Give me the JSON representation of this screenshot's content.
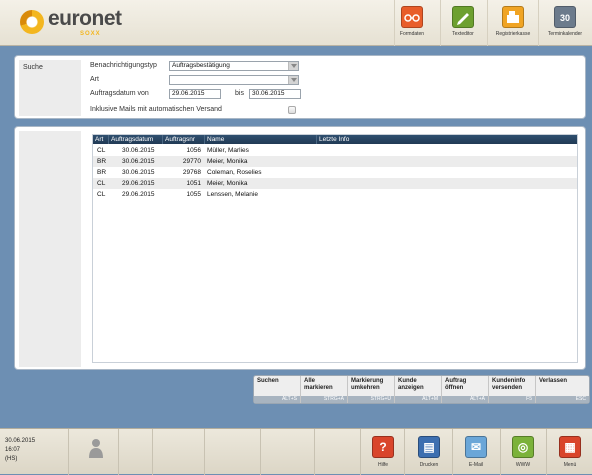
{
  "app": {
    "logo_name": "euronet",
    "logo_sub": "SOXX"
  },
  "toolbar": {
    "items": [
      {
        "label": "Formdaten",
        "icon": "glasses-icon",
        "color": "#e85d2a"
      },
      {
        "label": "Texteditor",
        "icon": "pencil-icon",
        "color": "#6da02f"
      },
      {
        "label": "Registrierkasse",
        "icon": "cash-register-icon",
        "color": "#f0a424"
      },
      {
        "label": "Terminkalender",
        "icon": "calendar-icon",
        "color": "#6c7b8c",
        "day": "30"
      }
    ]
  },
  "search": {
    "title": "Suche",
    "type_label": "Benachrichtigungstyp",
    "type_value": "Auftragsbestätigung",
    "art_label": "Art",
    "art_value": "",
    "date_label": "Auftragsdatum von",
    "date_from": "29.06.2015",
    "date_to_label": "bis",
    "date_to": "30.06.2015",
    "auto_mail_label": "Inklusive Mails mit automatischen Versand"
  },
  "results": {
    "columns": [
      "Art",
      "Auftragsdatum",
      "Auftragsnr",
      "Name",
      "Letzte Info"
    ],
    "rows": [
      {
        "art": "CL",
        "datum": "30.06.2015",
        "nr": "1056",
        "name": "Müller, Marlies",
        "info": ""
      },
      {
        "art": "BR",
        "datum": "30.06.2015",
        "nr": "29770",
        "name": "Meier, Monika",
        "info": ""
      },
      {
        "art": "BR",
        "datum": "30.06.2015",
        "nr": "29768",
        "name": "Coleman, Roselies",
        "info": ""
      },
      {
        "art": "CL",
        "datum": "29.06.2015",
        "nr": "1051",
        "name": "Meier, Monika",
        "info": ""
      },
      {
        "art": "CL",
        "datum": "29.06.2015",
        "nr": "1055",
        "name": "Lenssen, Melanie",
        "info": ""
      }
    ]
  },
  "fkeys": [
    {
      "l1": "Suchen",
      "l2": "",
      "key": "ALT+S"
    },
    {
      "l1": "Alle",
      "l2": "markieren",
      "key": "STRG+A"
    },
    {
      "l1": "Markierung",
      "l2": "umkehren",
      "key": "STRG+U"
    },
    {
      "l1": "Kunde",
      "l2": "anzeigen",
      "key": "ALT+M"
    },
    {
      "l1": "Auftrag",
      "l2": "öffnen",
      "key": "ALT+A"
    },
    {
      "l1": "Kundeninfo",
      "l2": "versenden",
      "key": "F5"
    },
    {
      "l1": "Verlassen",
      "l2": "",
      "key": "ESC"
    }
  ],
  "status": {
    "date": "30.06.2015",
    "time": "16:07",
    "user": "(HS)"
  },
  "bottom": {
    "items": [
      {
        "label": "Hilfe",
        "icon": "help-icon",
        "color": "#d9452b",
        "glyph": "?"
      },
      {
        "label": "Drucken",
        "icon": "printer-icon",
        "color": "#3d6fb0",
        "glyph": "▤"
      },
      {
        "label": "E-Mail",
        "icon": "mail-icon",
        "color": "#6aa6d8",
        "glyph": "✉"
      },
      {
        "label": "WWW",
        "icon": "globe-icon",
        "color": "#7bb23a",
        "glyph": "◎"
      },
      {
        "label": "Menü",
        "icon": "menu-icon",
        "color": "#d9452b",
        "glyph": "▦"
      }
    ]
  }
}
